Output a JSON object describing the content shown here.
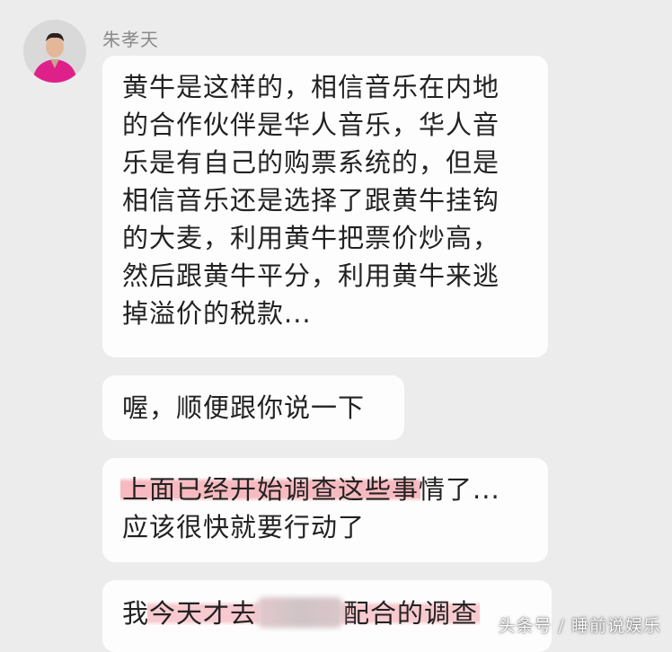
{
  "sender": {
    "name": "朱孝天",
    "avatar_icon": "user-avatar"
  },
  "messages": [
    {
      "lines": [
        "黄牛是这样的，相信音乐在内地",
        "的合作伙伴是华人音乐，华人音",
        "乐是有自己的购票系统的，但是",
        "相信音乐还是选择了跟黄牛挂钩",
        "的大麦，利用黄牛把票价炒高，",
        "然后跟黄牛平分，利用黄牛来逃",
        "掉溢价的税款..."
      ]
    },
    {
      "lines": [
        "喔，顺便跟你说一下"
      ]
    },
    {
      "line1_highlight": "上面已经开始调查这些事",
      "line1_rest": "情了...",
      "line2": "应该很快就要行动了"
    },
    {
      "prefix": "我",
      "highlight_a": "今天才去",
      "highlight_b": "配合的调查"
    }
  ],
  "watermark": "头条号 / 睡前说娱乐",
  "colors": {
    "background": "#ececec",
    "bubble": "#fdfdfd",
    "highlight": "#f496a0",
    "name": "#8a8a8a"
  }
}
